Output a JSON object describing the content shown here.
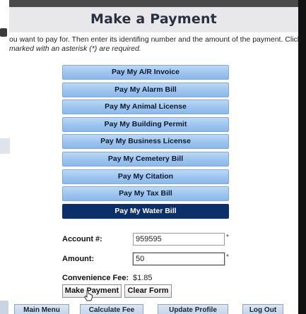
{
  "header": {
    "title": "Make a Payment"
  },
  "instructions": {
    "line1": "ou want to pay for. Then enter its identifing number and the amount of the payment. Click",
    "line2": "marked with an asterisk (*) are required."
  },
  "payment_types": [
    {
      "label": "Pay My A/R Invoice",
      "selected": false
    },
    {
      "label": "Pay My Alarm Bill",
      "selected": false
    },
    {
      "label": "Pay My Animal License",
      "selected": false
    },
    {
      "label": "Pay My Building Permit",
      "selected": false
    },
    {
      "label": "Pay My Business License",
      "selected": false
    },
    {
      "label": "Pay My Cemetery Bill",
      "selected": false
    },
    {
      "label": "Pay My Citation",
      "selected": false
    },
    {
      "label": "Pay My Tax Bill",
      "selected": false
    },
    {
      "label": "Pay My Water Bill",
      "selected": true
    }
  ],
  "form": {
    "account_label": "Account #:",
    "account_value": "959595",
    "amount_label": "Amount:",
    "amount_value": "50",
    "required_marker": "*",
    "fee_label": "Convenience Fee:",
    "fee_value": "$1.85"
  },
  "actions": {
    "make_payment": "Make Payment",
    "clear_form": "Clear Form"
  },
  "nav": {
    "main_menu": "Main Menu",
    "calculate_fee": "Calculate Fee",
    "update_profile": "Update Profile",
    "log_out": "Log Out"
  },
  "colors": {
    "button_blue": "#9cc4ef",
    "selected_navy": "#0a2f6b",
    "header_bg": "#e8e8ea"
  }
}
